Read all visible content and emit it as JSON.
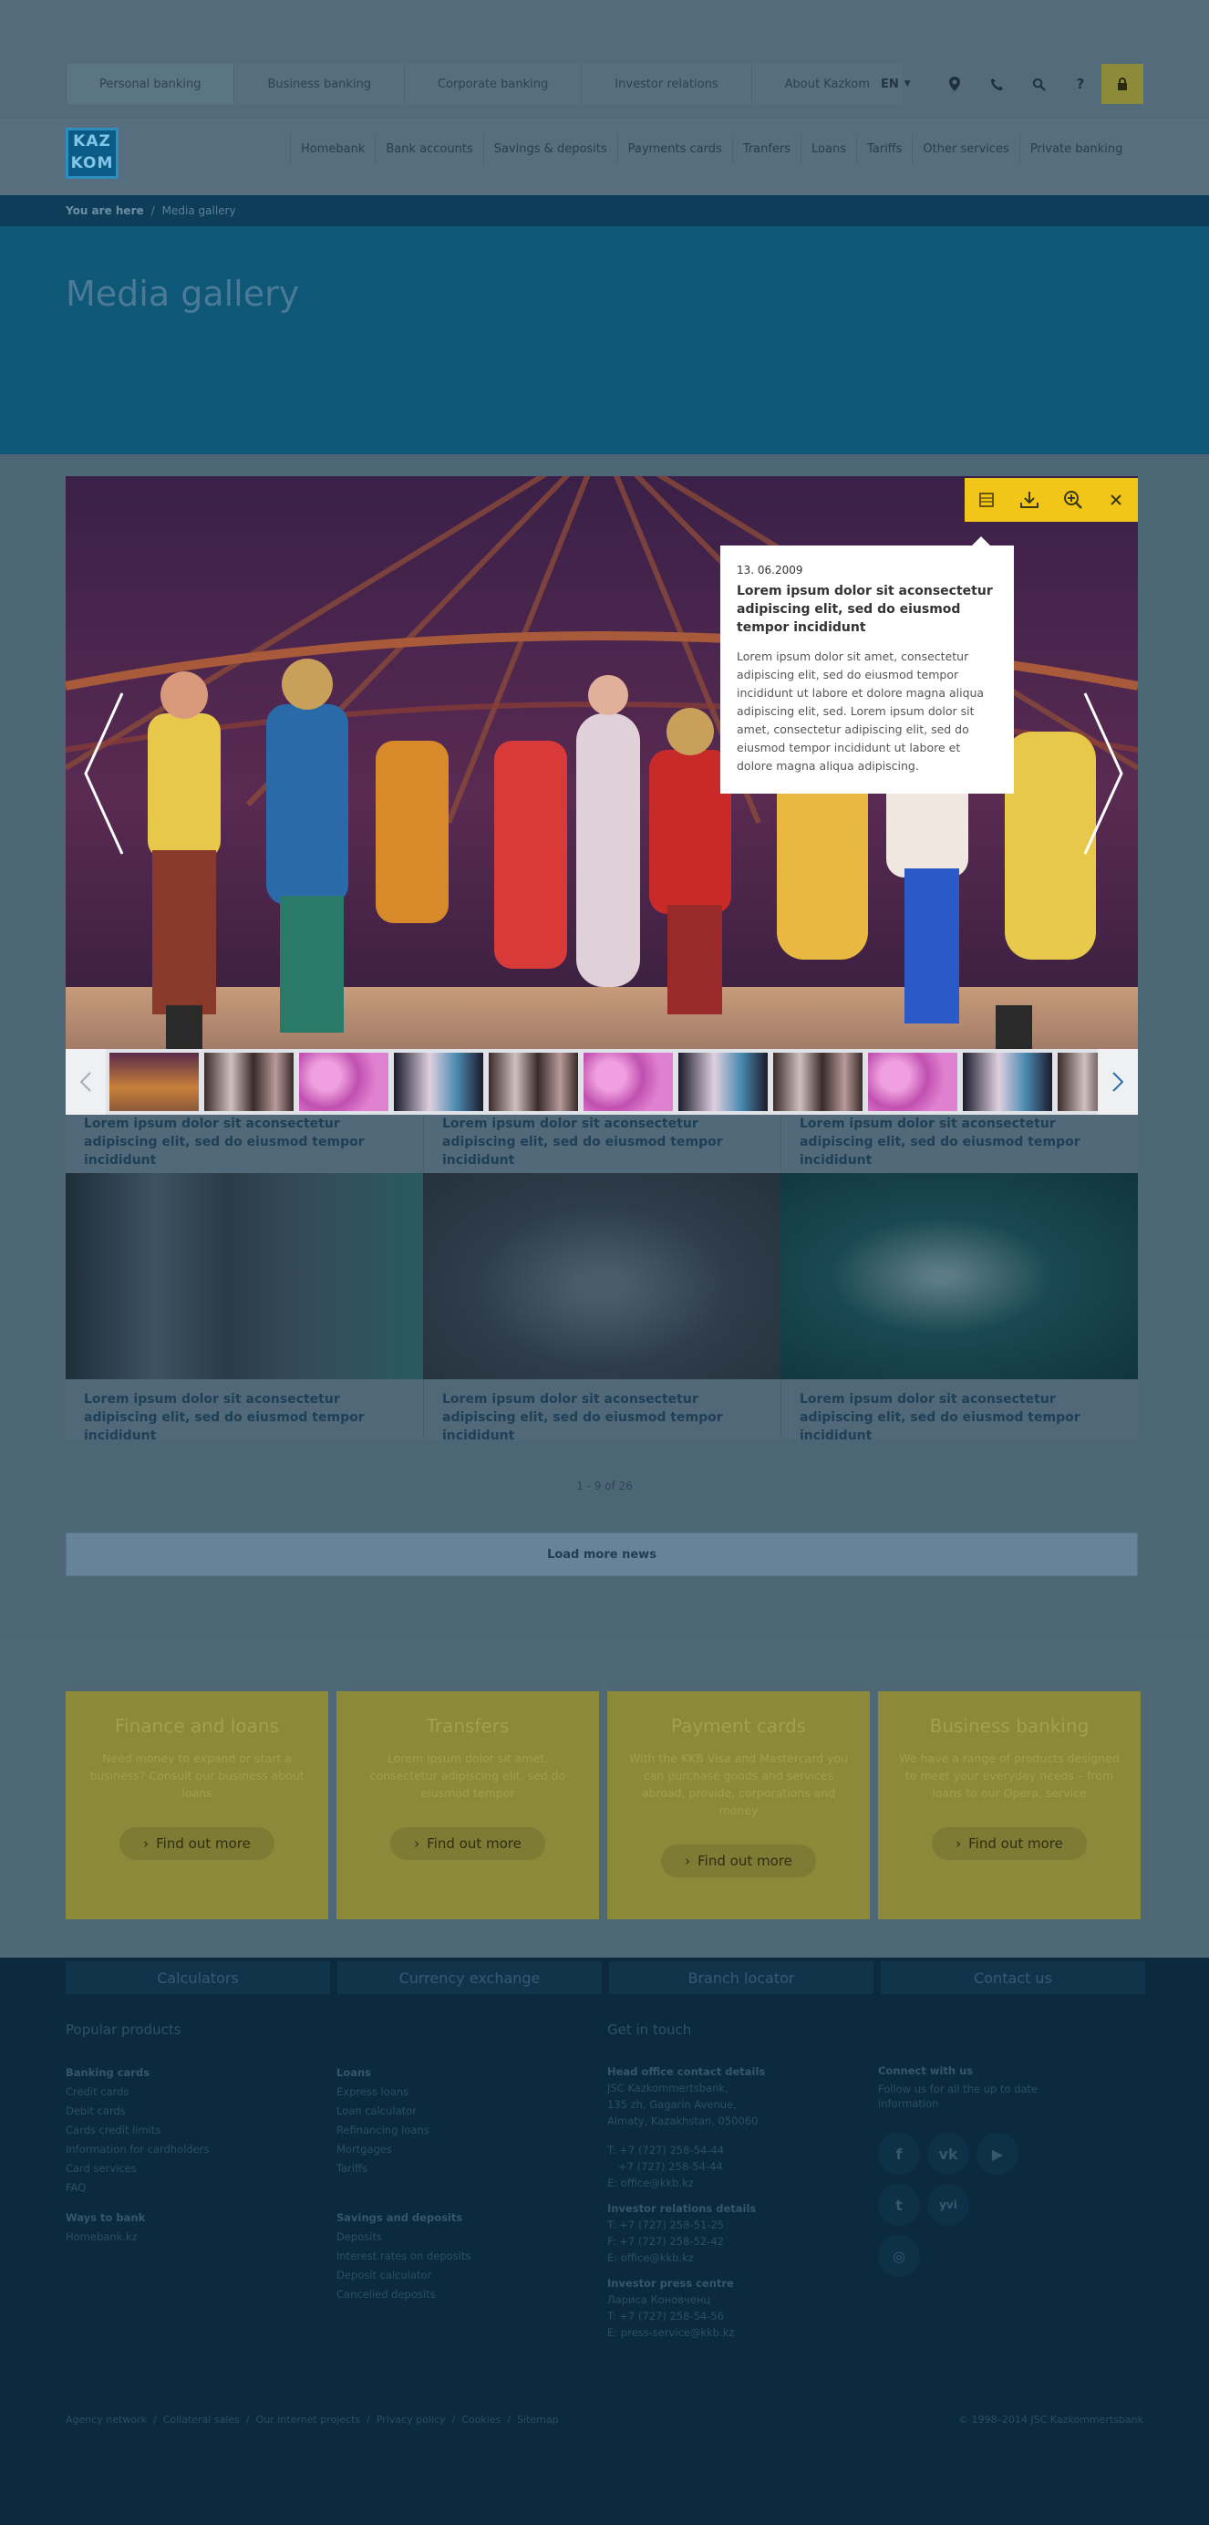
{
  "topnav": {
    "items": [
      "Personal banking",
      "Business banking",
      "Corporate banking",
      "Investor relations",
      "About Kazkom"
    ],
    "lang": "EN",
    "icons": [
      "location-icon",
      "phone-icon",
      "search-icon",
      "help-icon",
      "lock-icon"
    ]
  },
  "logo": {
    "line1": "KAZ",
    "line2": "KOM"
  },
  "mainnav": [
    "Homebank",
    "Bank accounts",
    "Savings & deposits",
    "Payments cards",
    "Tranfers",
    "Loans",
    "Tariffs",
    "Other services",
    "Private banking"
  ],
  "breadcrumb": {
    "label": "You are here",
    "separator": "/",
    "current": "Media gallery"
  },
  "page": {
    "title": "Media gallery"
  },
  "viewer": {
    "popup": {
      "date": "13. 06.2009",
      "title": "Lorem ipsum dolor sit aconsectetur adipiscing elit, sed do eiusmod tempor incididunt",
      "text": "Lorem ipsum dolor sit amet, consectetur adipiscing elit, sed do eiusmod tempor incididunt ut labore et dolore magna aliqua adipiscing elit, sed. Lorem ipsum dolor sit amet, consectetur adipiscing elit, sed do eiusmod tempor incididunt ut labore et dolore magna aliqua adipiscing."
    },
    "toolbar": [
      "gallery-icon",
      "download-icon",
      "zoom-icon",
      "close-icon"
    ]
  },
  "captions_row1": [
    "Lorem ipsum dolor sit aconsectetur adipiscing elit, sed do eiusmod tempor incididunt",
    "Lorem ipsum dolor sit aconsectetur adipiscing elit, sed do eiusmod tempor incididunt",
    "Lorem ipsum dolor sit aconsectetur adipiscing elit, sed do eiusmod tempor incididunt"
  ],
  "captions_row2": [
    "Lorem ipsum dolor sit aconsectetur adipiscing elit, sed do eiusmod tempor incididunt",
    "Lorem ipsum dolor sit aconsectetur adipiscing elit, sed do eiusmod tempor incididunt",
    "Lorem ipsum dolor sit aconsectetur adipiscing elit, sed do eiusmod tempor incididunt"
  ],
  "pager": "1 - 9 of 26",
  "load_more": "Load more news",
  "promos": [
    {
      "title": "Finance and loans",
      "text": "Need money to expand or start a business? Consult our business about loans",
      "button": "Find out more"
    },
    {
      "title": "Transfers",
      "text": "Lorem ipsum dolor sit amet, consectetur adipiscing elit, sed do eiusmod tempor",
      "button": "Find out more"
    },
    {
      "title": "Payment cards",
      "text": "With the KKB Visa and Mastercard you can purchase goods and services abroad, provide, corporations and money",
      "button": "Find out more"
    },
    {
      "title": "Business banking",
      "text": "We have a range of products designed to meet your everyday needs – from loans to our Opera, service",
      "button": "Find out more"
    }
  ],
  "footer_tabs": [
    "Calculators",
    "Currency exchange",
    "Branch locator",
    "Contact us"
  ],
  "footer": {
    "popular_title": "Popular products",
    "touch_title": "Get in touch",
    "col1": {
      "h1": "Banking cards",
      "items1": [
        "Credit cards",
        "Debit cards",
        "Cards credit limits",
        "Information for cardholders",
        "Card services",
        "FAQ"
      ],
      "h2": "Ways to bank",
      "items2": [
        "Homebank.kz"
      ]
    },
    "col2": {
      "h1": "Loans",
      "items1": [
        "Express loans",
        "Loan calculator",
        "Refinancing loans",
        "Mortgages",
        "Tariffs"
      ],
      "h2": "Savings and deposits",
      "items2": [
        "Deposits",
        "Interest rates on deposits",
        "Deposit calculator",
        "Cancelled deposits"
      ]
    },
    "col3": {
      "h1": "Head office contact details",
      "addr": [
        "JSC Kazkommertsbank,",
        "135 zh, Gagarin Avenue,",
        "Almaty, Kazakhstan, 050060"
      ],
      "phones": [
        "T: +7 (727) 258-54-44",
        "   +7 (727) 258-54-44",
        "E: office@kkb.kz"
      ],
      "h2": "Investor relations details",
      "inv": [
        "T: +7 (727) 258-51-25",
        "F: +7 (727) 258-52-42",
        "E: office@kkb.kz"
      ],
      "h3": "Investor press centre",
      "press": [
        "Лариса Коновченц",
        "T: +7 (727) 258-54-56",
        "E: press-service@kkb.kz"
      ]
    },
    "col4": {
      "h1": "Connect with us",
      "text": "Follow us for all the up to date information"
    },
    "social": [
      "f",
      "vk",
      "▶",
      "t",
      "yvi",
      "◎"
    ],
    "legal": [
      "Agency network",
      "Collateral sales",
      "Our internet projects",
      "Privacy policy",
      "Cookies",
      "Sitemap"
    ],
    "copyright": "© 1998–2014 JSC Kazkommertsbank"
  }
}
